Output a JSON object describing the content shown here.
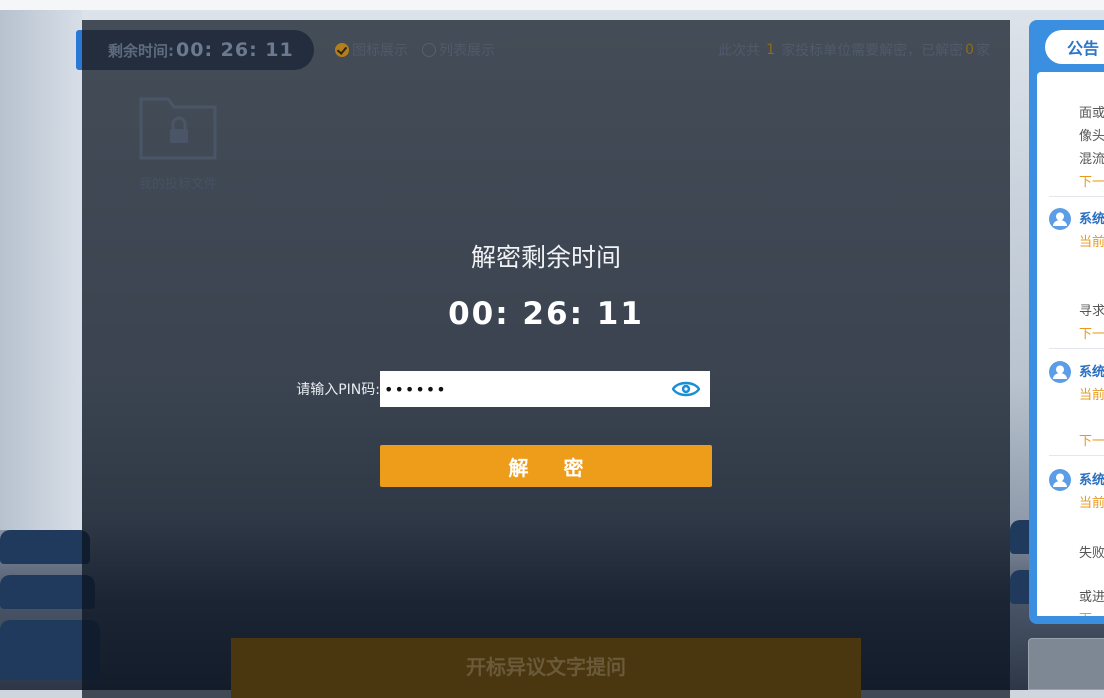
{
  "topbar": {
    "timer_label": "剩余时间:",
    "timer_value": "00: 26: 11",
    "view_icon": "图标展示",
    "view_list": "列表展示",
    "count_prefix": "此次共",
    "count_total": "1",
    "count_middle": "家投标单位需要解密，已解密",
    "count_done": "0",
    "count_suffix": "家"
  },
  "folder": {
    "caption": "我的投标文件",
    "icon": "lock-folder-icon"
  },
  "dialog": {
    "title": "解密剩余时间",
    "time": "00: 26: 11",
    "pin_label": "请输入PIN码:",
    "pin_value": "••••••",
    "decrypt_label": "解 密"
  },
  "bottom_button": "开标异议文字提问",
  "notice": {
    "tab": "公告",
    "lines": {
      "l1": "面或",
      "l2": "像头",
      "l3": "混流",
      "next1": "下一",
      "sys1": "系统",
      "cur1": "当前",
      "l4": "寻求",
      "next2": "下一",
      "sys2": "系统",
      "cur2": "当前",
      "next3": "下一",
      "sys3": "系统",
      "cur3": "当前",
      "l5": "失败",
      "l6": "或进",
      "next4": "下一"
    }
  },
  "colors": {
    "accent_orange": "#ee9d1b",
    "notice_blue": "#3b8fe0",
    "eye_blue": "#1a8fd6"
  }
}
